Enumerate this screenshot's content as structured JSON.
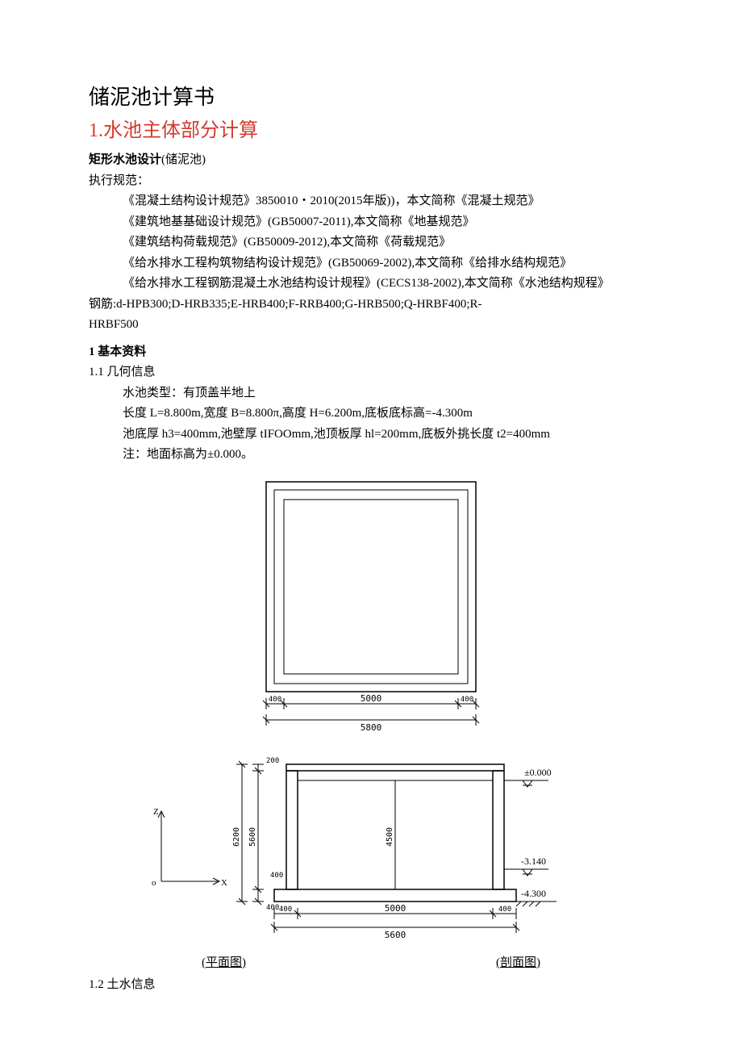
{
  "title": "储泥池计算书",
  "section1": "1.水池主体部分计算",
  "design_name": "矩形水池设计",
  "design_paren": "(储泥池)",
  "standards_label": "执行规范：",
  "standards": [
    "《混凝土结构设计规范》3850010・2010(2015年版))，本文简称《混凝土规范》",
    "《建筑地基基础设计规范》(GB50007-2011),本文简称《地基规范》",
    "《建筑结构荷载规范》(GB50009-2012),本文简称《荷载规范》",
    "《给水排水工程构筑物结构设计规范》(GB50069-2002),本文简称《给排水结构规范》",
    "《给水排水工程钢筋混凝土水池结构设计规程》(CECS138-2002),本文简称《水池结构规程》"
  ],
  "rebar_line1": "钢筋:d-HPB300;D-HRB335;E-HRB400;F-RRB400;G-HRB500;Q-HRBF400;R-",
  "rebar_line2": "HRBF500",
  "h_basic": "1 基本资料",
  "h_geom": "1.1 几何信息",
  "geom_lines": [
    "水池类型：有顶盖半地上",
    "长度 L=8.800m,宽度 B=8.800π,高度 H=6.200m,底板底标高=-4.300m",
    "池底厚 h3=400mm,池壁厚 tIFOOmm,池顶板厚 hl=200mm,底板外挑长度 t2=400mm",
    "注：地面标高为±0.000。"
  ],
  "fig": {
    "plan_w_inner": "5000",
    "plan_w_outer": "5800",
    "plan_t": "400",
    "sec_h_outer": "6200",
    "sec_h_inner": "5600",
    "sec_t_top": "200",
    "sec_t_wall": "400",
    "sec_t_base": "400",
    "sec_w_inner": "5000",
    "sec_w_outer": "5600",
    "level_ground": "±0.000",
    "level_mid": "-3.140",
    "level_base": "-4.300",
    "sec_inner_h": "4500",
    "caption_plan": "(平面图)",
    "caption_sec": "(剖面图)"
  },
  "h_soil": "1.2 土水信息"
}
